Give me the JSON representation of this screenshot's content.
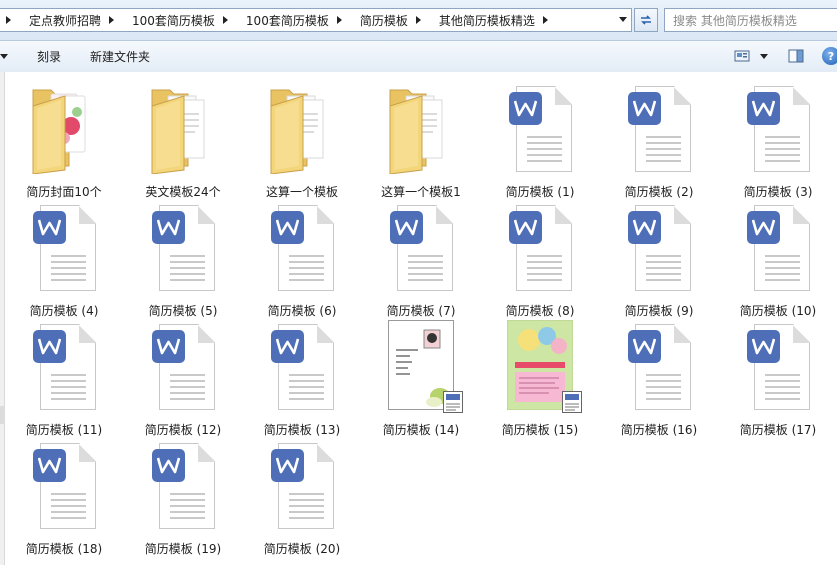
{
  "address": {
    "crumbs": [
      "定点教师招聘",
      "100套简历模板",
      "100套简历模板",
      "简历模板",
      "其他简历模板精选"
    ]
  },
  "search": {
    "placeholder": "搜索 其他简历模板精选"
  },
  "toolbar": {
    "burn_label": "刻录",
    "new_folder_label": "新建文件夹",
    "help_label": "?"
  },
  "files": [
    {
      "name": "简历封面10个",
      "type": "folder-photo"
    },
    {
      "name": "英文模板24个",
      "type": "folder"
    },
    {
      "name": "这算一个模板",
      "type": "folder"
    },
    {
      "name": "这算一个模板1",
      "type": "folder"
    },
    {
      "name": "简历模板 (1)",
      "type": "wps"
    },
    {
      "name": "简历模板 (2)",
      "type": "wps"
    },
    {
      "name": "简历模板 (3)",
      "type": "wps"
    },
    {
      "name": "简历模板 (4)",
      "type": "wps"
    },
    {
      "name": "简历模板 (5)",
      "type": "wps"
    },
    {
      "name": "简历模板 (6)",
      "type": "wps"
    },
    {
      "name": "简历模板 (7)",
      "type": "wps"
    },
    {
      "name": "简历模板 (8)",
      "type": "wps"
    },
    {
      "name": "简历模板 (9)",
      "type": "wps"
    },
    {
      "name": "简历模板 (10)",
      "type": "wps"
    },
    {
      "name": "简历模板 (11)",
      "type": "wps"
    },
    {
      "name": "简历模板 (12)",
      "type": "wps"
    },
    {
      "name": "简历模板 (13)",
      "type": "wps"
    },
    {
      "name": "简历模板 (14)",
      "type": "thumb-white"
    },
    {
      "name": "简历模板 (15)",
      "type": "thumb-color"
    },
    {
      "name": "简历模板 (16)",
      "type": "wps"
    },
    {
      "name": "简历模板 (17)",
      "type": "wps"
    },
    {
      "name": "简历模板 (18)",
      "type": "wps"
    },
    {
      "name": "简历模板 (19)",
      "type": "wps"
    },
    {
      "name": "简历模板 (20)",
      "type": "wps"
    }
  ],
  "colors": {
    "wps_badge": "#4e6fb7",
    "folder_yellow": "#f3d57a",
    "selection_blue": "#2b62b0"
  }
}
